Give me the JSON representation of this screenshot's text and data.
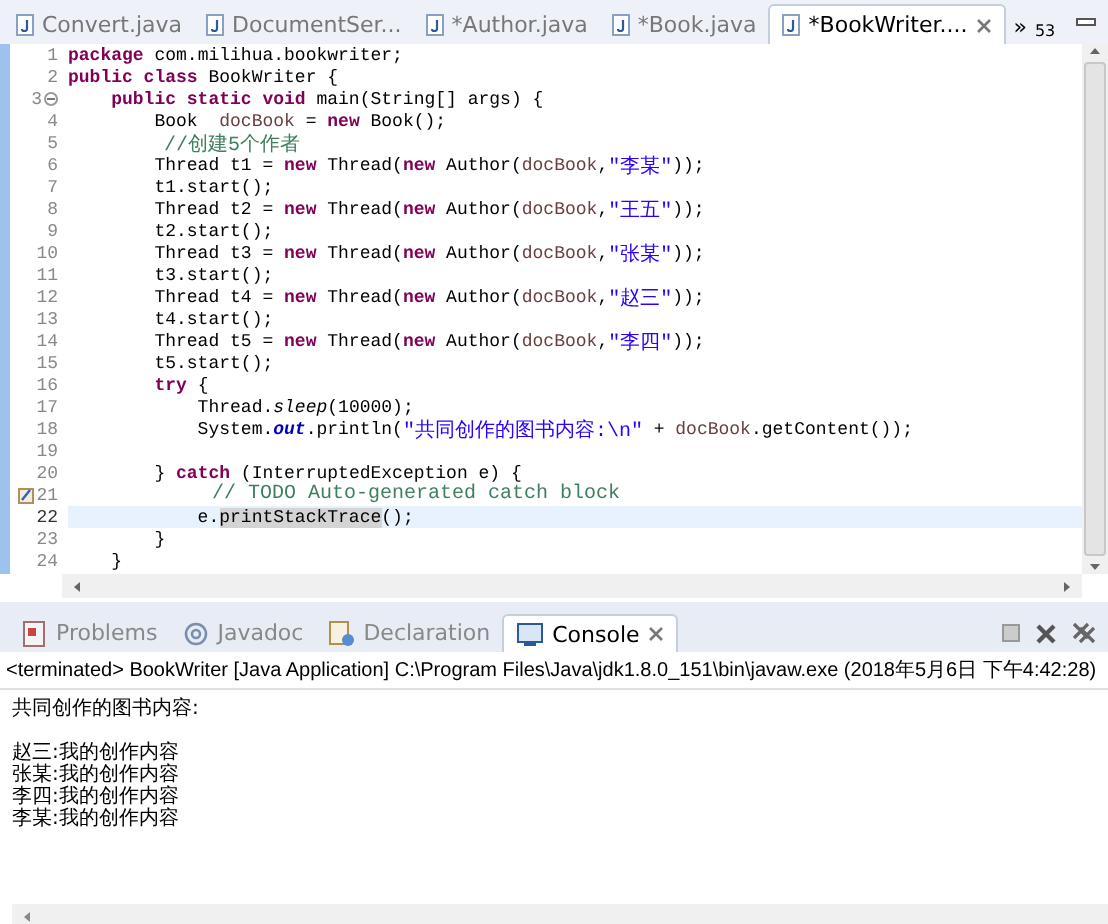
{
  "editor_tabs": [
    {
      "label": "Convert.java",
      "selected": false
    },
    {
      "label": "DocumentSer...",
      "selected": false
    },
    {
      "label": "*Author.java",
      "selected": false
    },
    {
      "label": "*Book.java",
      "selected": false
    },
    {
      "label": "*BookWriter....",
      "selected": true
    }
  ],
  "tab_overflow": {
    "label": "»",
    "count": "53"
  },
  "code_lines": [
    {
      "num": "1",
      "current": false,
      "tokens": [
        {
          "kind": "keyword",
          "text": "package"
        },
        {
          "kind": "plain",
          "text": " com.milihua.bookwriter;"
        }
      ]
    },
    {
      "num": "2",
      "current": false,
      "tokens": [
        {
          "kind": "keyword",
          "text": "public class"
        },
        {
          "kind": "plain",
          "text": " BookWriter {"
        }
      ]
    },
    {
      "num": "3",
      "current": false,
      "kind": "fold",
      "tokens": [
        {
          "kind": "keyword",
          "text": "    public static void"
        },
        {
          "kind": "plain",
          "text": " main(String[] args) {"
        }
      ]
    },
    {
      "num": "4",
      "current": false,
      "tokens": [
        {
          "kind": "plain",
          "text": "        Book  "
        },
        {
          "kind": "variable",
          "text": "docBook"
        },
        {
          "kind": "plain",
          "text": " = "
        },
        {
          "kind": "keyword",
          "text": "new"
        },
        {
          "kind": "plain",
          "text": " Book();"
        }
      ]
    },
    {
      "num": "5",
      "current": false,
      "tokens": [
        {
          "kind": "comment",
          "text": "        //创建5个作者"
        }
      ]
    },
    {
      "num": "6",
      "current": false,
      "tokens": [
        {
          "kind": "plain",
          "text": "        Thread t1 = "
        },
        {
          "kind": "keyword",
          "text": "new"
        },
        {
          "kind": "plain",
          "text": " Thread("
        },
        {
          "kind": "keyword",
          "text": "new"
        },
        {
          "kind": "plain",
          "text": " Author("
        },
        {
          "kind": "variable",
          "text": "docBook"
        },
        {
          "kind": "plain",
          "text": ","
        },
        {
          "kind": "string",
          "text": "\"李某\""
        },
        {
          "kind": "plain",
          "text": "));"
        }
      ]
    },
    {
      "num": "7",
      "current": false,
      "tokens": [
        {
          "kind": "plain",
          "text": "        t1.start();"
        }
      ]
    },
    {
      "num": "8",
      "current": false,
      "tokens": [
        {
          "kind": "plain",
          "text": "        Thread t2 = "
        },
        {
          "kind": "keyword",
          "text": "new"
        },
        {
          "kind": "plain",
          "text": " Thread("
        },
        {
          "kind": "keyword",
          "text": "new"
        },
        {
          "kind": "plain",
          "text": " Author("
        },
        {
          "kind": "variable",
          "text": "docBook"
        },
        {
          "kind": "plain",
          "text": ","
        },
        {
          "kind": "string",
          "text": "\"王五\""
        },
        {
          "kind": "plain",
          "text": "));"
        }
      ]
    },
    {
      "num": "9",
      "current": false,
      "tokens": [
        {
          "kind": "plain",
          "text": "        t2.start();"
        }
      ]
    },
    {
      "num": "10",
      "current": false,
      "tokens": [
        {
          "kind": "plain",
          "text": "        Thread t3 = "
        },
        {
          "kind": "keyword",
          "text": "new"
        },
        {
          "kind": "plain",
          "text": " Thread("
        },
        {
          "kind": "keyword",
          "text": "new"
        },
        {
          "kind": "plain",
          "text": " Author("
        },
        {
          "kind": "variable",
          "text": "docBook"
        },
        {
          "kind": "plain",
          "text": ","
        },
        {
          "kind": "string",
          "text": "\"张某\""
        },
        {
          "kind": "plain",
          "text": "));"
        }
      ]
    },
    {
      "num": "11",
      "current": false,
      "tokens": [
        {
          "kind": "plain",
          "text": "        t3.start();"
        }
      ]
    },
    {
      "num": "12",
      "current": false,
      "tokens": [
        {
          "kind": "plain",
          "text": "        Thread t4 = "
        },
        {
          "kind": "keyword",
          "text": "new"
        },
        {
          "kind": "plain",
          "text": " Thread("
        },
        {
          "kind": "keyword",
          "text": "new"
        },
        {
          "kind": "plain",
          "text": " Author("
        },
        {
          "kind": "variable",
          "text": "docBook"
        },
        {
          "kind": "plain",
          "text": ","
        },
        {
          "kind": "string",
          "text": "\"赵三\""
        },
        {
          "kind": "plain",
          "text": "));"
        }
      ]
    },
    {
      "num": "13",
      "current": false,
      "tokens": [
        {
          "kind": "plain",
          "text": "        t4.start();"
        }
      ]
    },
    {
      "num": "14",
      "current": false,
      "tokens": [
        {
          "kind": "plain",
          "text": "        Thread t5 = "
        },
        {
          "kind": "keyword",
          "text": "new"
        },
        {
          "kind": "plain",
          "text": " Thread("
        },
        {
          "kind": "keyword",
          "text": "new"
        },
        {
          "kind": "plain",
          "text": " Author("
        },
        {
          "kind": "variable",
          "text": "docBook"
        },
        {
          "kind": "plain",
          "text": ","
        },
        {
          "kind": "string",
          "text": "\"李四\""
        },
        {
          "kind": "plain",
          "text": "));"
        }
      ]
    },
    {
      "num": "15",
      "current": false,
      "tokens": [
        {
          "kind": "plain",
          "text": "        t5.start();"
        }
      ]
    },
    {
      "num": "16",
      "current": false,
      "tokens": [
        {
          "kind": "keyword",
          "text": "        try"
        },
        {
          "kind": "plain",
          "text": " {"
        }
      ]
    },
    {
      "num": "17",
      "current": false,
      "tokens": [
        {
          "kind": "plain",
          "text": "            Thread."
        },
        {
          "kind": "static",
          "text": "sleep"
        },
        {
          "kind": "plain",
          "text": "(10000);"
        }
      ]
    },
    {
      "num": "18",
      "current": false,
      "tokens": [
        {
          "kind": "plain",
          "text": "            System."
        },
        {
          "kind": "field",
          "text": "out"
        },
        {
          "kind": "plain",
          "text": ".println("
        },
        {
          "kind": "string",
          "text": "\"共同创作的图书内容:\\n\""
        },
        {
          "kind": "plain",
          "text": " + "
        },
        {
          "kind": "variable",
          "text": "docBook"
        },
        {
          "kind": "plain",
          "text": ".getContent());"
        }
      ]
    },
    {
      "num": "19",
      "current": false
    },
    {
      "num": "20",
      "current": false,
      "tokens": [
        {
          "kind": "plain",
          "text": "        } "
        },
        {
          "kind": "keyword",
          "text": "catch"
        },
        {
          "kind": "plain",
          "text": " (InterruptedException e) {"
        }
      ]
    },
    {
      "num": "21",
      "current": false,
      "kind": "task",
      "tokens": [
        {
          "kind": "comment",
          "text": "            // TODO Auto-generated catch block"
        }
      ]
    },
    {
      "num": "22",
      "current": true,
      "tokens": [
        {
          "kind": "plain",
          "text": "            e."
        },
        {
          "kind": "highlight",
          "text": "printStackTrace"
        },
        {
          "kind": "plain",
          "text": "();"
        }
      ]
    },
    {
      "num": "23",
      "current": false,
      "tokens": [
        {
          "kind": "plain",
          "text": "        }"
        }
      ]
    },
    {
      "num": "24",
      "current": false,
      "tokens": [
        {
          "kind": "plain",
          "text": "    }"
        }
      ]
    }
  ],
  "console_tabs": [
    {
      "label": "Problems",
      "selected": false
    },
    {
      "label": "Javadoc",
      "selected": false
    },
    {
      "label": "Declaration",
      "selected": false
    },
    {
      "label": "Console",
      "selected": true
    }
  ],
  "console_status": "<terminated> BookWriter [Java Application] C:\\Program Files\\Java\\jdk1.8.0_151\\bin\\javaw.exe (2018年5月6日 下午4:42:28)",
  "console_heading": "共同创作的图书内容:",
  "console_output": [
    "赵三:我的创作内容",
    "张某:我的创作内容",
    "李四:我的创作内容",
    "李某:我的创作内容"
  ]
}
